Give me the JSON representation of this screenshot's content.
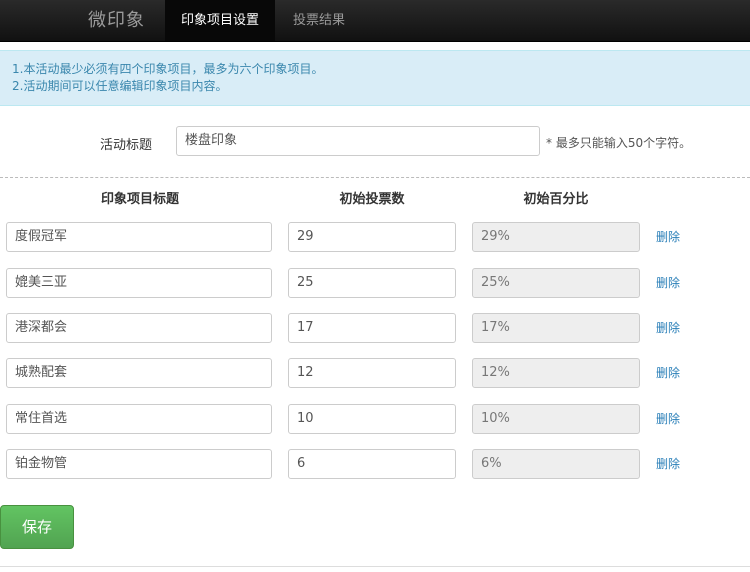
{
  "header": {
    "brand": "微印象",
    "tabs": [
      {
        "label": "印象项目设置",
        "active": true
      },
      {
        "label": "投票结果",
        "active": false
      }
    ]
  },
  "notice": {
    "line1": "1.本活动最少必须有四个印象项目，最多为六个印象项目。",
    "line2": "2.活动期间可以任意编辑印象项目内容。"
  },
  "form": {
    "title_label": "活动标题",
    "title_value": "楼盘印象",
    "title_hint": "* 最多只能输入50个字符。"
  },
  "table": {
    "headers": [
      "印象项目标题",
      "初始投票数",
      "初始百分比"
    ],
    "delete_label": "删除",
    "rows": [
      {
        "name": "度假冠军",
        "votes": "29",
        "percent": "29%"
      },
      {
        "name": "媲美三亚",
        "votes": "25",
        "percent": "25%"
      },
      {
        "name": "港深都会",
        "votes": "17",
        "percent": "17%"
      },
      {
        "name": "城熟配套",
        "votes": "12",
        "percent": "12%"
      },
      {
        "name": "常住首选",
        "votes": "10",
        "percent": "10%"
      },
      {
        "name": "铂金物管",
        "votes": "6",
        "percent": "6%"
      }
    ]
  },
  "actions": {
    "save_label": "保存"
  },
  "colors": {
    "notice_bg": "#d9edf7",
    "notice_text": "#3a87ad",
    "link": "#2a7fb8",
    "save_green": "#5bb75b"
  }
}
